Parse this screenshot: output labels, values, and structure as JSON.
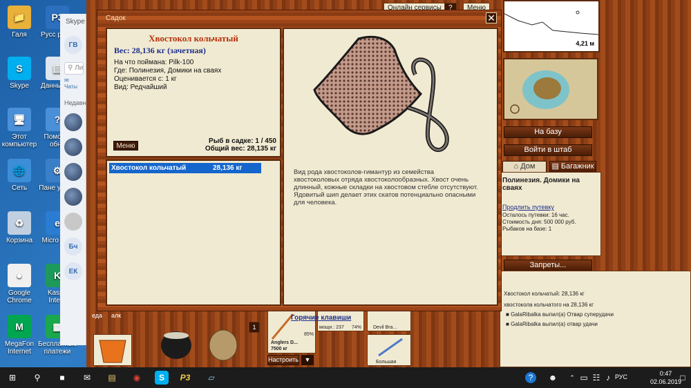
{
  "desktop": {
    "icons": [
      {
        "label": "Галя",
        "color": "#e8b13a",
        "glyph": "📁"
      },
      {
        "label": "Русс рыба",
        "color": "#2b6fbe",
        "glyph": "Р3"
      },
      {
        "label": "Skype",
        "color": "#00aff0",
        "glyph": "S"
      },
      {
        "label": "Данны игр",
        "color": "#dfe6ee",
        "glyph": "▤"
      },
      {
        "label": "Этот компьютер",
        "color": "#4a90d9",
        "glyph": "🖥"
      },
      {
        "label": "Помо по обно",
        "color": "#4a90d9",
        "glyph": "?"
      },
      {
        "label": "Сеть",
        "color": "#3c8ed8",
        "glyph": "🌐"
      },
      {
        "label": "Пане управ",
        "color": "#3a7fc8",
        "glyph": "⚙"
      },
      {
        "label": "Корзина",
        "color": "#c0d0e0",
        "glyph": "♻"
      },
      {
        "label": "Micro Edg",
        "color": "#2b7cd3",
        "glyph": "e"
      },
      {
        "label": "Google Chrome",
        "color": "#f0f0f0",
        "glyph": "●"
      },
      {
        "label": "Kaspe Intern",
        "color": "#1d9a5a",
        "glyph": "K"
      },
      {
        "label": "MegaFon Internet",
        "color": "#00a650",
        "glyph": "M"
      },
      {
        "label": "Бесплатные платежи",
        "color": "#1aa84d",
        "glyph": "▦"
      }
    ]
  },
  "skype": {
    "title": "Skype",
    "avatar": "ГВ",
    "search": "Ли",
    "chats": "Чаты",
    "recent": "Недавн",
    "contacts": [
      "",
      "",
      "",
      "",
      "",
      "Бч",
      "ЕК"
    ]
  },
  "game": {
    "top_buttons": [
      "Онлайн сервисы",
      "?",
      "Меню"
    ],
    "depth": "4,21 м",
    "nav_buttons": [
      "На базу",
      "Войти в штаб"
    ],
    "tabs": [
      "Дом",
      "Багажник"
    ],
    "location": {
      "title": "Полинезия. Домики на сваях",
      "extend_link": "Продлить путевку",
      "lines": [
        "Осталось путевки: 16 час.",
        "Стоимость дня: 500 000 руб.",
        "Рыбаков на базе: 1"
      ]
    },
    "bans_button": "Запреты...",
    "chat": [
      "Хвостокол кольчатый: 28,136 кг",
      "хвостокола кольчатого на 28,136 кг",
      "GalaRibalka выпил(а) Отвар суперудачи",
      "GalaRibalka выпил(а) отвар удачи"
    ],
    "inventory": {
      "food_labels": [
        "еда",
        "алк"
      ],
      "tackle_name": "Anglers D...",
      "tackle_weight": "7500 кг",
      "tackle_pct": "85%",
      "reel_label": "мощн.: 237",
      "reel_pct": "74%",
      "lure_label": "Devil Bra...",
      "lure2_label": "Большая",
      "setup_button": "Настроить",
      "badge": "1"
    }
  },
  "dialog": {
    "title": "Садок",
    "fish_name": "Хвостокол кольчатый",
    "weight": "Вес: 28,136 кг (зачетная)",
    "details": [
      "На что поймана: Pilk-100",
      "Где: Полинезия, Домики на сваях",
      "Оценивается с: 1 кг",
      "Вид: Редчайший"
    ],
    "menu_button": "Меню",
    "count": "Рыб в садке: 1 / 450",
    "total_weight": "Общий вес: 28,135 кг",
    "list": [
      {
        "name": "Хвостокол кольчатый",
        "weight": "28,136 кг"
      }
    ],
    "description": "Вид рода хвостоколов-гимантур из семейства хвостоколовых отряда хвостоколообразных. Хвост очень длинный, кожные складки на хвостовом стебле отсутствуют. Ядовитый шип делает этих скатов потенциально опасными для человека.",
    "hotkeys_link": "Горячие клавиши"
  },
  "taskbar": {
    "lang": "РУС",
    "time": "0:47",
    "date": "02.06.2019",
    "app_label": "Р3"
  }
}
